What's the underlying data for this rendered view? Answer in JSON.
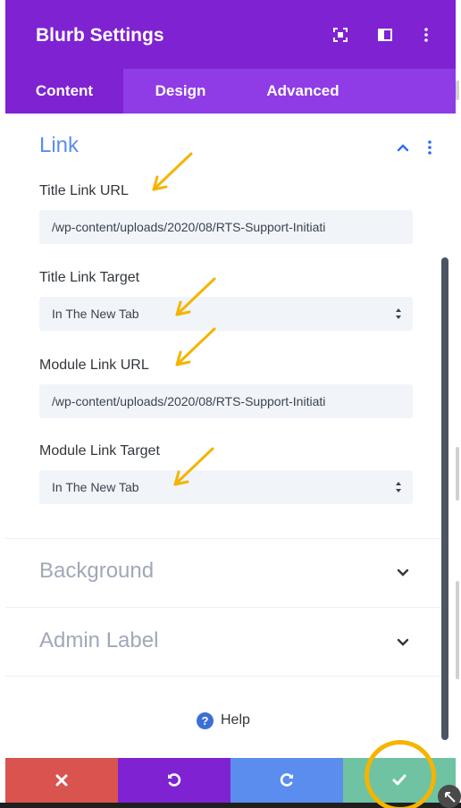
{
  "header": {
    "title": "Blurb Settings",
    "icons": [
      "focus-icon",
      "columns-icon",
      "more-vertical-icon"
    ]
  },
  "tabs": [
    {
      "label": "Content",
      "active": true
    },
    {
      "label": "Design",
      "active": false
    },
    {
      "label": "Advanced",
      "active": false
    }
  ],
  "link_section": {
    "title": "Link",
    "expanded": true,
    "title_link_url_label": "Title Link URL",
    "title_link_url_value": "/wp-content/uploads/2020/08/RTS-Support-Initiati",
    "title_link_target_label": "Title Link Target",
    "title_link_target_value": "In The New Tab",
    "module_link_url_label": "Module Link URL",
    "module_link_url_value": "/wp-content/uploads/2020/08/RTS-Support-Initiati",
    "module_link_target_label": "Module Link Target",
    "module_link_target_value": "In The New Tab"
  },
  "collapsed_sections": [
    {
      "title": "Background"
    },
    {
      "title": "Admin Label"
    }
  ],
  "help": {
    "icon": "?",
    "label": "Help"
  },
  "footer": {
    "buttons": [
      {
        "name": "discard",
        "icon": "close-icon",
        "color": "#d9534f"
      },
      {
        "name": "undo",
        "icon": "undo-icon",
        "color": "#7e22d2"
      },
      {
        "name": "redo",
        "icon": "redo-icon",
        "color": "#5b8def"
      },
      {
        "name": "save",
        "icon": "check-icon",
        "color": "#6fc3a3"
      }
    ]
  },
  "colors": {
    "header": "#7e22d2",
    "tabs": "#8f3ce6",
    "section_title": "#5b8def",
    "annotation": "#f5b400"
  }
}
